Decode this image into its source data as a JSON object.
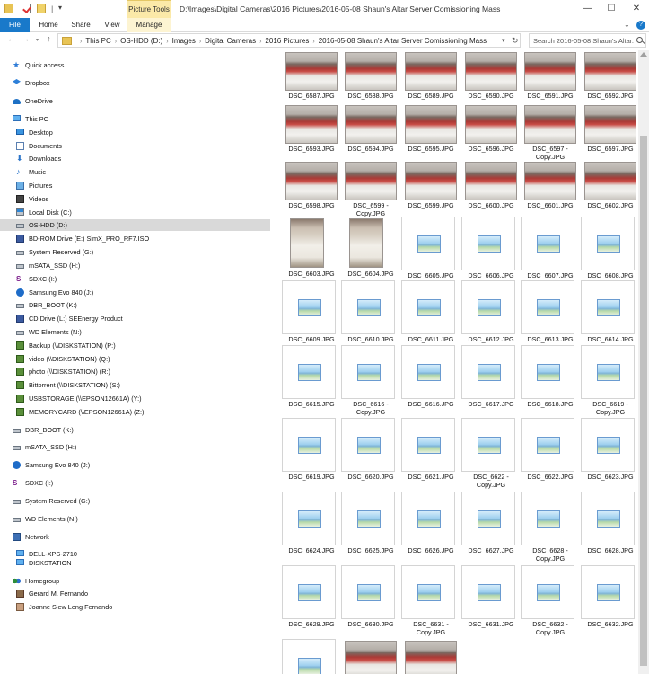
{
  "titlebar": {
    "context_tab": "Picture Tools",
    "title": "D:\\Images\\Digital Cameras\\2016 Pictures\\2016-05-08 Shaun's Altar Server Comissioning Mass",
    "min": "—",
    "max": "☐",
    "close": "✕",
    "qa_sep": "|",
    "qa_dropdown": "▾"
  },
  "ribbon": {
    "tabs": [
      "File",
      "Home",
      "Share",
      "View",
      "Manage"
    ],
    "expand": "⌄",
    "help": "?"
  },
  "address": {
    "back": "←",
    "forward": "→",
    "recent": "▾",
    "up": "↑",
    "crumbs": [
      "This PC",
      "OS-HDD (D:)",
      "Images",
      "Digital Cameras",
      "2016 Pictures",
      "2016-05-08 Shaun's Altar Server Comissioning Mass"
    ],
    "crumb_separator": "›",
    "dropdown": "▾",
    "refresh": "↻",
    "search_placeholder": "Search 2016-05-08 Shaun's Altar..."
  },
  "nav": {
    "items": [
      {
        "label": "Quick access",
        "icon": "star-icon"
      },
      {
        "label": "Dropbox",
        "icon": "dropbox-icon"
      },
      {
        "label": "OneDrive",
        "icon": "onedrive-icon"
      },
      {
        "label": "This PC",
        "icon": "this-pc-icon"
      },
      {
        "label": "Desktop",
        "icon": "desktop-icon"
      },
      {
        "label": "Documents",
        "icon": "documents-icon"
      },
      {
        "label": "Downloads",
        "icon": "downloads-icon"
      },
      {
        "label": "Music",
        "icon": "music-icon"
      },
      {
        "label": "Pictures",
        "icon": "pictures-icon"
      },
      {
        "label": "Videos",
        "icon": "videos-icon"
      },
      {
        "label": "Local Disk (C:)",
        "icon": "windows-drive-icon"
      },
      {
        "label": "OS-HDD (D:)",
        "icon": "drive-icon",
        "selected": true
      },
      {
        "label": "BD-ROM Drive (E:) SimX_PRO_RF7.ISO",
        "icon": "disc-drive-icon"
      },
      {
        "label": "System Reserved (G:)",
        "icon": "drive-icon"
      },
      {
        "label": "mSATA_SSD (H:)",
        "icon": "drive-icon"
      },
      {
        "label": "SDXC (I:)",
        "icon": "sd-card-icon"
      },
      {
        "label": "Samsung Evo 840 (J:)",
        "icon": "samsung-drive-icon"
      },
      {
        "label": "DBR_BOOT (K:)",
        "icon": "drive-icon"
      },
      {
        "label": "CD Drive (L:) SEEnergy Product",
        "icon": "cd-drive-icon"
      },
      {
        "label": "WD Elements (N:)",
        "icon": "drive-icon"
      },
      {
        "label": "Backup (\\\\DISKSTATION) (P:)",
        "icon": "network-drive-icon"
      },
      {
        "label": "video (\\\\DISKSTATION) (Q:)",
        "icon": "network-drive-icon"
      },
      {
        "label": "photo (\\\\DISKSTATION) (R:)",
        "icon": "network-drive-icon"
      },
      {
        "label": "Bittorrent (\\\\DISKSTATION) (S:)",
        "icon": "network-drive-icon"
      },
      {
        "label": "USBSTORAGE (\\\\EPSON12661A) (Y:)",
        "icon": "network-drive-icon"
      },
      {
        "label": "MEMORYCARD (\\\\EPSON12661A) (Z:)",
        "icon": "network-drive-icon"
      },
      {
        "label": "DBR_BOOT (K:)",
        "icon": "drive-icon"
      },
      {
        "label": "mSATA_SSD (H:)",
        "icon": "drive-icon"
      },
      {
        "label": "Samsung Evo 840 (J:)",
        "icon": "samsung-drive-icon"
      },
      {
        "label": "SDXC (I:)",
        "icon": "sd-card-icon"
      },
      {
        "label": "System Reserved (G:)",
        "icon": "drive-icon"
      },
      {
        "label": "WD Elements (N:)",
        "icon": "drive-icon"
      },
      {
        "label": "Network",
        "icon": "network-icon"
      },
      {
        "label": "DELL-XPS-2710",
        "icon": "network-computer-icon"
      },
      {
        "label": "DISKSTATION",
        "icon": "network-computer-icon"
      },
      {
        "label": "Homegroup",
        "icon": "homegroup-icon"
      },
      {
        "label": "Gerard M. Fernando",
        "icon": "user-avatar-icon"
      },
      {
        "label": "Joanne Siew Leng Fernando",
        "icon": "user-avatar-icon"
      }
    ]
  },
  "files": [
    {
      "name": "DSC_6587.JPG",
      "thumb": "photo-group"
    },
    {
      "name": "DSC_6588.JPG",
      "thumb": "photo-group"
    },
    {
      "name": "DSC_6589.JPG",
      "thumb": "photo-group"
    },
    {
      "name": "DSC_6590.JPG",
      "thumb": "photo-group"
    },
    {
      "name": "DSC_6591.JPG",
      "thumb": "photo-group"
    },
    {
      "name": "DSC_6592.JPG",
      "thumb": "photo-group"
    },
    {
      "name": "DSC_6593.JPG",
      "thumb": "photo-group"
    },
    {
      "name": "DSC_6594.JPG",
      "thumb": "photo-group"
    },
    {
      "name": "DSC_6595.JPG",
      "thumb": "photo-group"
    },
    {
      "name": "DSC_6596.JPG",
      "thumb": "photo-group"
    },
    {
      "name": "DSC_6597 - Copy.JPG",
      "thumb": "photo-group"
    },
    {
      "name": "DSC_6597.JPG",
      "thumb": "photo-group"
    },
    {
      "name": "DSC_6598.JPG",
      "thumb": "photo-group"
    },
    {
      "name": "DSC_6599 - Copy.JPG",
      "thumb": "photo-group"
    },
    {
      "name": "DSC_6599.JPG",
      "thumb": "photo-group"
    },
    {
      "name": "DSC_6600.JPG",
      "thumb": "photo-group"
    },
    {
      "name": "DSC_6601.JPG",
      "thumb": "photo-group"
    },
    {
      "name": "DSC_6602.JPG",
      "thumb": "photo-group"
    },
    {
      "name": "DSC_6603.JPG",
      "thumb": "photo-portrait"
    },
    {
      "name": "DSC_6604.JPG",
      "thumb": "photo-portrait"
    },
    {
      "name": "DSC_6605.JPG",
      "thumb": "generic"
    },
    {
      "name": "DSC_6606.JPG",
      "thumb": "generic"
    },
    {
      "name": "DSC_6607.JPG",
      "thumb": "generic"
    },
    {
      "name": "DSC_6608.JPG",
      "thumb": "generic"
    },
    {
      "name": "DSC_6609.JPG",
      "thumb": "generic"
    },
    {
      "name": "DSC_6610.JPG",
      "thumb": "generic"
    },
    {
      "name": "DSC_6611.JPG",
      "thumb": "generic"
    },
    {
      "name": "DSC_6612.JPG",
      "thumb": "generic"
    },
    {
      "name": "DSC_6613.JPG",
      "thumb": "generic"
    },
    {
      "name": "DSC_6614.JPG",
      "thumb": "generic"
    },
    {
      "name": "DSC_6615.JPG",
      "thumb": "generic"
    },
    {
      "name": "DSC_6616 - Copy.JPG",
      "thumb": "generic"
    },
    {
      "name": "DSC_6616.JPG",
      "thumb": "generic"
    },
    {
      "name": "DSC_6617.JPG",
      "thumb": "generic"
    },
    {
      "name": "DSC_6618.JPG",
      "thumb": "generic"
    },
    {
      "name": "DSC_6619 - Copy.JPG",
      "thumb": "generic"
    },
    {
      "name": "DSC_6619.JPG",
      "thumb": "generic"
    },
    {
      "name": "DSC_6620.JPG",
      "thumb": "generic"
    },
    {
      "name": "DSC_6621.JPG",
      "thumb": "generic"
    },
    {
      "name": "DSC_6622 - Copy.JPG",
      "thumb": "generic"
    },
    {
      "name": "DSC_6622.JPG",
      "thumb": "generic"
    },
    {
      "name": "DSC_6623.JPG",
      "thumb": "generic"
    },
    {
      "name": "DSC_6624.JPG",
      "thumb": "generic"
    },
    {
      "name": "DSC_6625.JPG",
      "thumb": "generic"
    },
    {
      "name": "DSC_6626.JPG",
      "thumb": "generic"
    },
    {
      "name": "DSC_6627.JPG",
      "thumb": "generic"
    },
    {
      "name": "DSC_6628 - Copy.JPG",
      "thumb": "generic"
    },
    {
      "name": "DSC_6628.JPG",
      "thumb": "generic"
    },
    {
      "name": "DSC_6629.JPG",
      "thumb": "generic"
    },
    {
      "name": "DSC_6630.JPG",
      "thumb": "generic"
    },
    {
      "name": "DSC_6631 - Copy.JPG",
      "thumb": "generic"
    },
    {
      "name": "DSC_6631.JPG",
      "thumb": "generic"
    },
    {
      "name": "DSC_6632 - Copy.JPG",
      "thumb": "generic"
    },
    {
      "name": "DSC_6632.JPG",
      "thumb": "generic"
    },
    {
      "name": "",
      "thumb": "generic"
    },
    {
      "name": "",
      "thumb": "photo-group"
    },
    {
      "name": "",
      "thumb": "photo-group"
    }
  ],
  "colors": {
    "accent": "#1979ca",
    "selection": "#d9d9d9",
    "context_tab": "#fbe9a8"
  }
}
